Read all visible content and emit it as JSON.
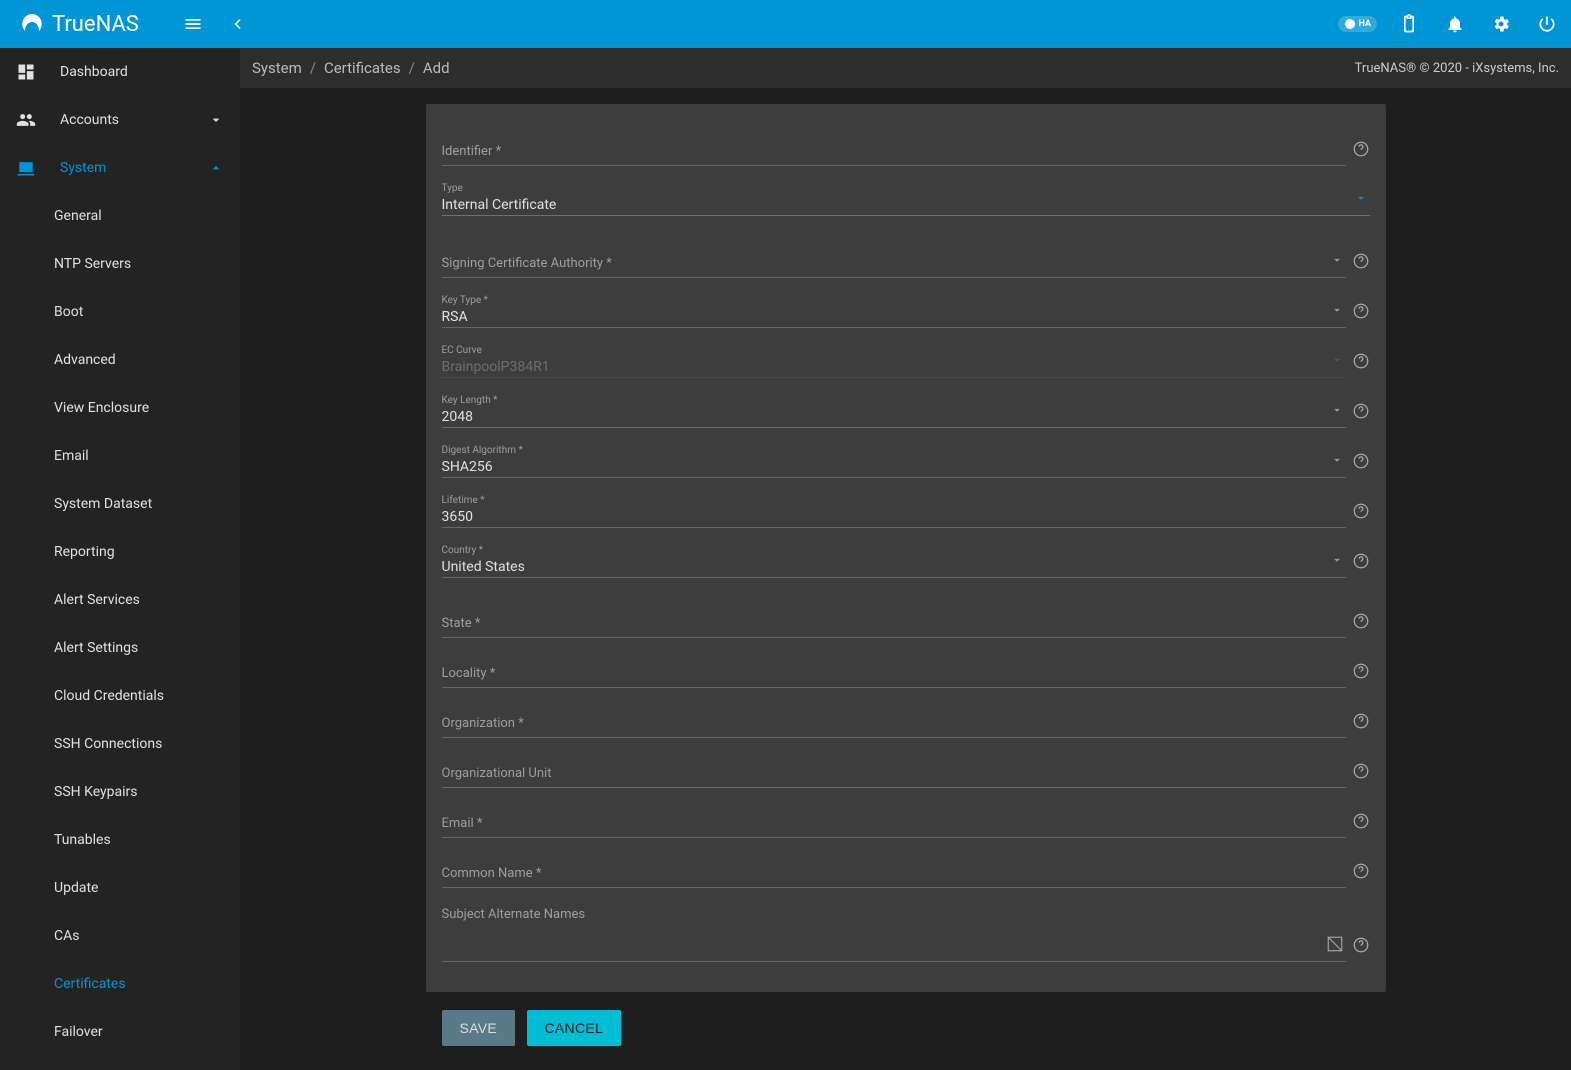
{
  "brand": "TrueNAS",
  "topbar_icons": {
    "ha": "HA",
    "clipboard": "clipboard",
    "bell": "notifications",
    "gear": "settings",
    "power": "power"
  },
  "sidebar": {
    "dashboard": "Dashboard",
    "accounts": "Accounts",
    "system": "System",
    "system_children": [
      "General",
      "NTP Servers",
      "Boot",
      "Advanced",
      "View Enclosure",
      "Email",
      "System Dataset",
      "Reporting",
      "Alert Services",
      "Alert Settings",
      "Cloud Credentials",
      "SSH Connections",
      "SSH Keypairs",
      "Tunables",
      "Update",
      "CAs",
      "Certificates",
      "Failover"
    ]
  },
  "breadcrumb": [
    "System",
    "Certificates",
    "Add"
  ],
  "copyright": "TrueNAS® © 2020 - iXsystems, Inc.",
  "form": {
    "identifier": {
      "label": "Identifier *",
      "value": ""
    },
    "type": {
      "label": "Type",
      "value": "Internal Certificate"
    },
    "signing_ca": {
      "label": "Signing Certificate Authority *",
      "value": ""
    },
    "key_type": {
      "label": "Key Type *",
      "value": "RSA"
    },
    "ec_curve": {
      "label": "EC Curve",
      "value": "BrainpoolP384R1"
    },
    "key_length": {
      "label": "Key Length *",
      "value": "2048"
    },
    "digest": {
      "label": "Digest Algorithm *",
      "value": "SHA256"
    },
    "lifetime": {
      "label": "Lifetime *",
      "value": "3650"
    },
    "country": {
      "label": "Country *",
      "value": "United States"
    },
    "state": {
      "label": "State *",
      "value": ""
    },
    "locality": {
      "label": "Locality *",
      "value": ""
    },
    "organization": {
      "label": "Organization *",
      "value": ""
    },
    "org_unit": {
      "label": "Organizational Unit",
      "value": ""
    },
    "email": {
      "label": "Email *",
      "value": ""
    },
    "common_name": {
      "label": "Common Name *",
      "value": ""
    },
    "san": {
      "label": "Subject Alternate Names",
      "value": ""
    }
  },
  "buttons": {
    "save": "SAVE",
    "cancel": "CANCEL"
  }
}
